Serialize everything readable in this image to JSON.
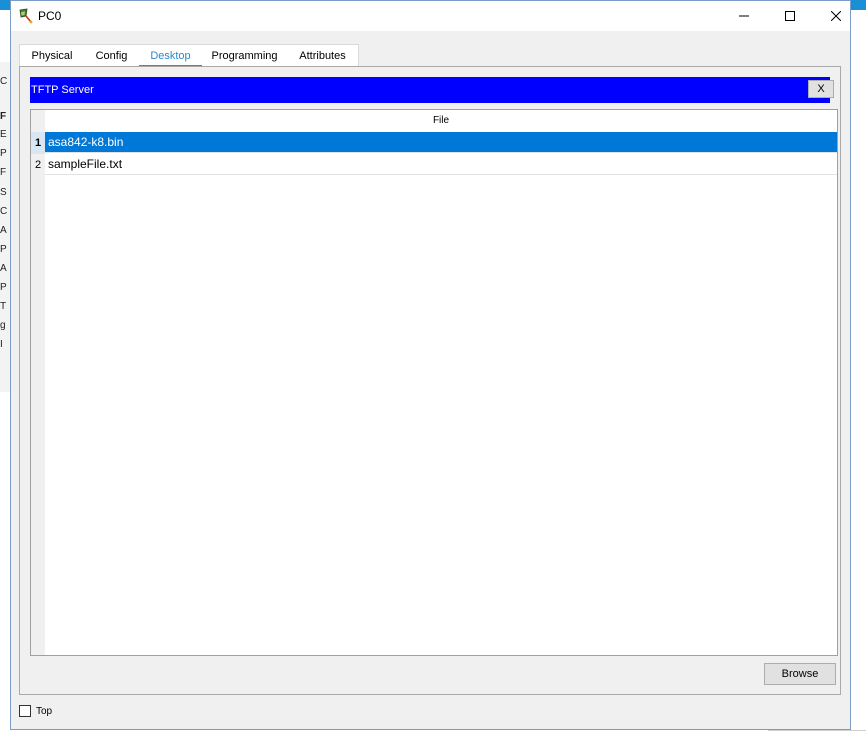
{
  "window": {
    "title": "PC0"
  },
  "tabs": [
    {
      "label": "Physical",
      "active": false
    },
    {
      "label": "Config",
      "active": false
    },
    {
      "label": "Desktop",
      "active": true
    },
    {
      "label": "Programming",
      "active": false
    },
    {
      "label": "Attributes",
      "active": false
    }
  ],
  "app": {
    "title": "TFTP Server",
    "close_label": "X",
    "header_color": "#0000ff",
    "table": {
      "column_header": "File",
      "rows": [
        {
          "num": "1",
          "name": "asa842-k8.bin",
          "selected": true
        },
        {
          "num": "2",
          "name": "sampleFile.txt",
          "selected": false
        }
      ]
    },
    "browse_label": "Browse"
  },
  "footer": {
    "top_label": "Top",
    "top_checked": false
  },
  "accent_color": "#2196d3",
  "selection_color": "#0078d7",
  "background_letters": [
    "C",
    "F",
    "E",
    "P",
    "F",
    "S",
    "C",
    "A",
    "P",
    "A",
    "P",
    "T",
    "g",
    "I"
  ]
}
